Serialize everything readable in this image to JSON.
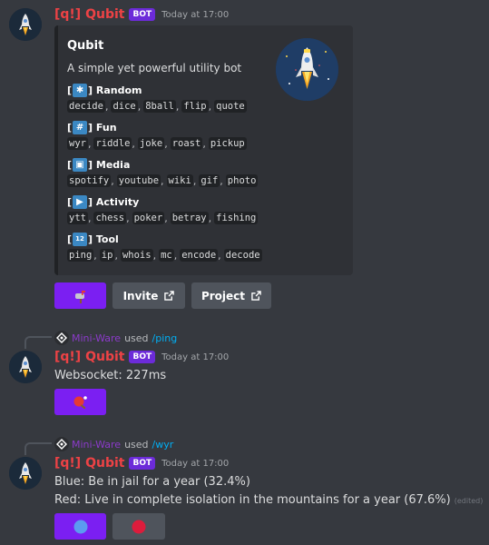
{
  "bot": {
    "name": "[q!] Qubit",
    "tag": "BOT",
    "timestamp": "Today at 17:00"
  },
  "help_embed": {
    "title": "Qubit",
    "description": "A simple yet powerful utility bot",
    "categories": [
      {
        "emoji": "asterisk-icon",
        "label": "Random",
        "commands": [
          "decide",
          "dice",
          "8ball",
          "flip",
          "quote"
        ]
      },
      {
        "emoji": "hash-icon",
        "label": "Fun",
        "commands": [
          "wyr",
          "riddle",
          "joke",
          "roast",
          "pickup"
        ]
      },
      {
        "emoji": "camera-icon",
        "label": "Media",
        "commands": [
          "spotify",
          "youtube",
          "wiki",
          "gif",
          "photo"
        ]
      },
      {
        "emoji": "play-pause-icon",
        "label": "Activity",
        "commands": [
          "ytt",
          "chess",
          "poker",
          "betray",
          "fishing"
        ]
      },
      {
        "emoji": "numbers-icon",
        "label": "Tool",
        "commands": [
          "ping",
          "ip",
          "whois",
          "mc",
          "encode",
          "decode"
        ]
      }
    ],
    "buttons": {
      "invite": "Invite",
      "project": "Project"
    }
  },
  "ping_message": {
    "reply_user": "Mini-Ware",
    "reply_used": "used",
    "reply_command": "/ping",
    "text": "Websocket: 227ms"
  },
  "wyr_message": {
    "reply_user": "Mini-Ware",
    "reply_used": "used",
    "reply_command": "/wyr",
    "line_blue": "Blue: Be in jail for a year (32.4%)",
    "line_red": "Red: Live in complete isolation in the mountains for a year (67.6%)",
    "edited": "(edited)"
  },
  "colors": {
    "background": "#36393f",
    "bot_name": "#ed4245",
    "button_primary": "#7b1ff2",
    "button_secondary": "#4f545c",
    "command_link": "#00aff4",
    "mini_ware": "#8b3ac9"
  }
}
